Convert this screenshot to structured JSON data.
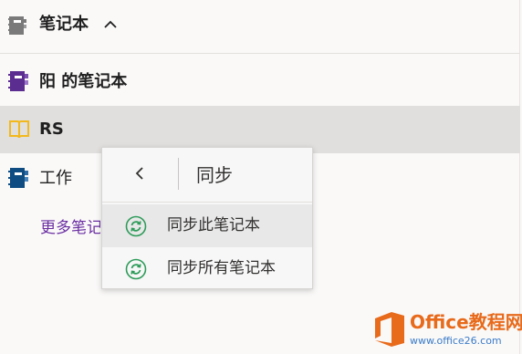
{
  "header": {
    "title": "笔记本",
    "chevron_icon": "chevron-up-icon",
    "notebook_icon": "notebook-gray-icon"
  },
  "notebooks": [
    {
      "label": "阳 的笔记本",
      "icon": "notebook-purple-icon",
      "color": "#5c2d91"
    },
    {
      "label": "RS",
      "icon": "open-book-yellow-icon",
      "color": "#f2b81c",
      "selected": true
    },
    {
      "label": "工作",
      "icon": "notebook-blue-icon",
      "color": "#0f4c81"
    }
  ],
  "more_link": "更多笔记本",
  "context_menu": {
    "back_icon": "chevron-left-icon",
    "title": "同步",
    "items": [
      {
        "label": "同步此笔记本",
        "icon": "sync-icon"
      },
      {
        "label": "同步所有笔记本",
        "icon": "sync-icon"
      }
    ],
    "sync_color": "#2e9c5a"
  },
  "watermark": {
    "brand": "Office教程网",
    "url": "www.office26.com",
    "color": "#e86a1b"
  }
}
